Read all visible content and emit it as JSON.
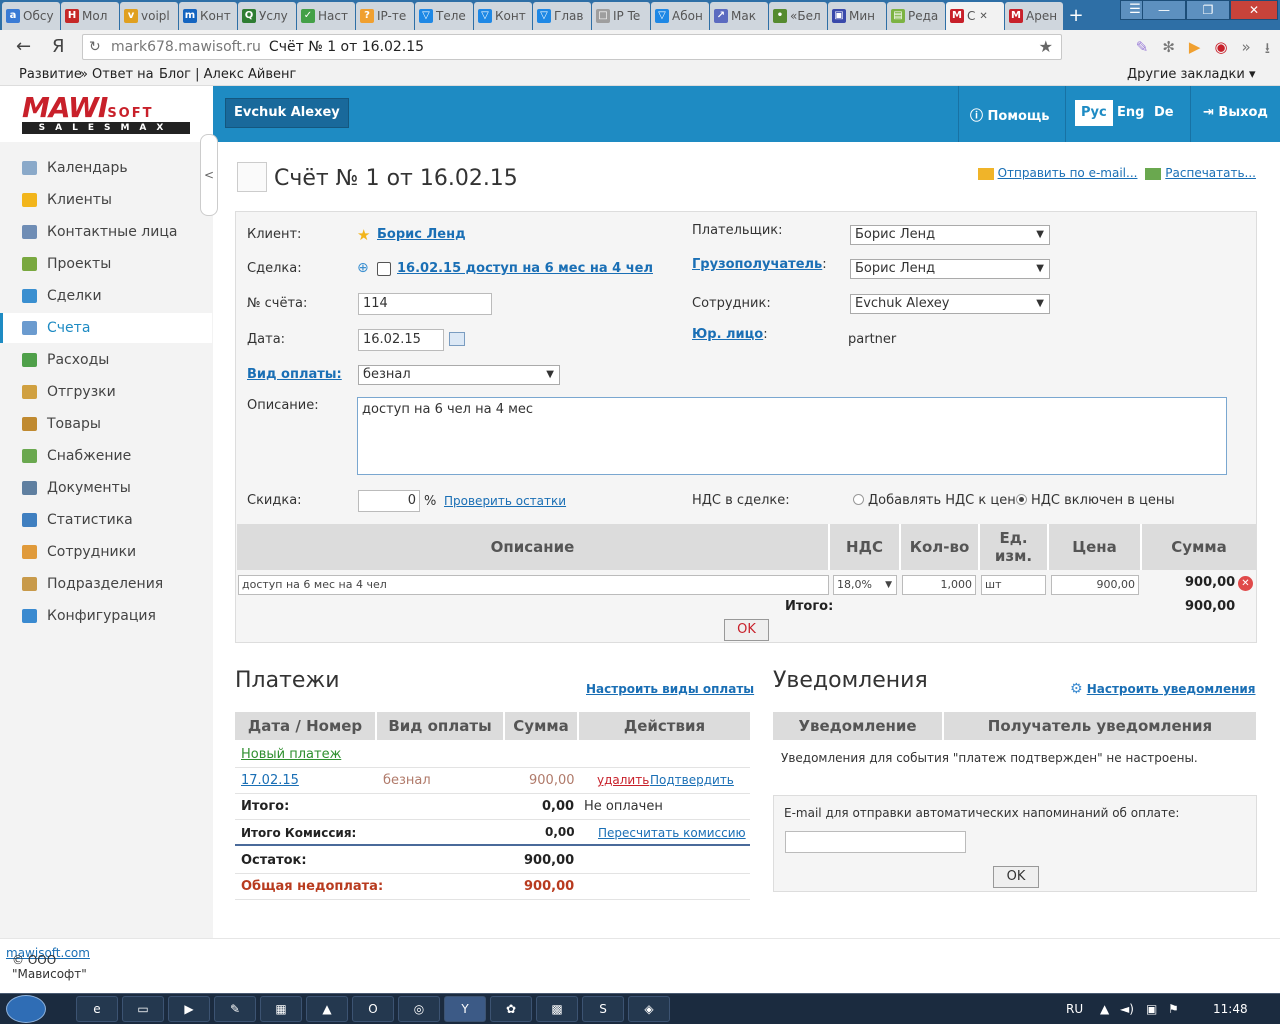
{
  "browser": {
    "tabs": [
      {
        "label": "Обсу",
        "icon": "a",
        "color": "#3a7bd5"
      },
      {
        "label": "Мол",
        "icon": "Н",
        "color": "#c62828"
      },
      {
        "label": "voipl",
        "icon": "v",
        "color": "#e0a020"
      },
      {
        "label": "Конт",
        "icon": "m",
        "color": "#1565c0"
      },
      {
        "label": "Услу",
        "icon": "Q",
        "color": "#2e7d32"
      },
      {
        "label": "Наст",
        "icon": "✓",
        "color": "#43a047"
      },
      {
        "label": "IP-те",
        "icon": "?",
        "color": "#f0a030"
      },
      {
        "label": "Теле",
        "icon": "▽",
        "color": "#1e88e5"
      },
      {
        "label": "Конт",
        "icon": "▽",
        "color": "#1e88e5"
      },
      {
        "label": "Глав",
        "icon": "▽",
        "color": "#1e88e5"
      },
      {
        "label": "IP Te",
        "icon": "□",
        "color": "#9e9e9e"
      },
      {
        "label": "Абон",
        "icon": "▽",
        "color": "#1e88e5"
      },
      {
        "label": "Мак",
        "icon": "↗",
        "color": "#5c6bc0"
      },
      {
        "label": "«Бел",
        "icon": "•",
        "color": "#558b2f"
      },
      {
        "label": "Мин",
        "icon": "▣",
        "color": "#3949ab"
      },
      {
        "label": "Реда",
        "icon": "▤",
        "color": "#7cb342"
      },
      {
        "label": "С",
        "icon": "M",
        "color": "#c8202a",
        "active": true
      },
      {
        "label": "Арен",
        "icon": "M",
        "color": "#c8202a"
      }
    ],
    "back_icon": "←",
    "yandex_icon": "Я",
    "url_host": "mark678.mawisoft.ru",
    "url_title": "Счёт № 1 от 16.02.15",
    "bookmarks": {
      "item1": "Развитие",
      "more": "»",
      "item2": "Ответ на",
      "item3": "Блог | Алекс Айвенг",
      "others": "Другие закладки ▾"
    }
  },
  "header": {
    "logo_main": "MAWI",
    "logo_soft": "SOFT",
    "logo_sub": "SALESMAX",
    "user": "Evchuk Alexey",
    "help": "Помощь",
    "langs": [
      "Рус",
      "Eng",
      "De"
    ],
    "exit": "Выход"
  },
  "sidebar": {
    "items": [
      {
        "label": "Календарь",
        "color": "#8aa9c9"
      },
      {
        "label": "Клиенты",
        "color": "#f2b51b"
      },
      {
        "label": "Контактные лица",
        "color": "#6f8db5"
      },
      {
        "label": "Проекты",
        "color": "#79a83f"
      },
      {
        "label": "Сделки",
        "color": "#3a8fd0"
      },
      {
        "label": "Счета",
        "color": "#6b9bcf",
        "active": true
      },
      {
        "label": "Расходы",
        "color": "#4fa04a"
      },
      {
        "label": "Отгрузки",
        "color": "#d0a040"
      },
      {
        "label": "Товары",
        "color": "#c08a30"
      },
      {
        "label": "Снабжение",
        "color": "#6aa84f"
      },
      {
        "label": "Документы",
        "color": "#5f7fa0"
      },
      {
        "label": "Статистика",
        "color": "#3f7fc0"
      },
      {
        "label": "Сотрудники",
        "color": "#e09a3a"
      },
      {
        "label": "Подразделения",
        "color": "#c89a4a"
      },
      {
        "label": "Конфигурация",
        "color": "#3a8ad0"
      }
    ],
    "collapse": "<"
  },
  "page": {
    "title": "Счёт № 1 от 16.02.15",
    "send_email": "Отправить по e-mail...",
    "print": "Распечатать..."
  },
  "form": {
    "client_label": "Клиент:",
    "client_value": "Борис Ленд",
    "deal_label": "Сделка:",
    "deal_value": "16.02.15 доступ на 6 мес на 4 чел",
    "number_label": "№ счёта:",
    "number_value": "114",
    "date_label": "Дата:",
    "date_value": "16.02.15",
    "payment_type_label": "Вид оплаты:",
    "payment_type_value": "безнал",
    "description_label": "Описание:",
    "description_value": "доступ на 6 чел на 4 мес",
    "discount_label": "Скидка:",
    "discount_value": "0",
    "discount_unit": "%",
    "check_stock": "Проверить остатки",
    "payer_label": "Плательщик:",
    "payer_value": "Борис Ленд",
    "consignee_label": "Грузополучатель",
    "consignee_colon": ":",
    "consignee_value": "Борис Ленд",
    "employee_label": "Сотрудник:",
    "employee_value": "Evchuk Alexey",
    "legal_label": "Юр. лицо",
    "legal_colon": ":",
    "legal_value": "partner",
    "vat_label": "НДС в сделке:",
    "vat_option1": "Добавлять НДС к цене",
    "vat_option2": "НДС включен в цены",
    "vat_selected": 2
  },
  "items_table": {
    "headers": [
      "Описание",
      "НДС",
      "Кол-во",
      "Ед. изм.",
      "Цена",
      "Сумма"
    ],
    "rows": [
      {
        "description": "доступ на 6 мес на 4 чел",
        "vat": "18,0%",
        "qty": "1,000",
        "unit": "шт",
        "price": "900,00",
        "sum": "900,00"
      }
    ],
    "total_label": "Итого:",
    "total_value": "900,00",
    "ok": "OK"
  },
  "payments": {
    "title": "Платежи",
    "configure": "Настроить виды оплаты",
    "headers": [
      "Дата / Номер",
      "Вид оплаты",
      "Сумма",
      "Действия"
    ],
    "new_payment": "Новый платеж",
    "rows": [
      {
        "date": "17.02.15",
        "type": "безнал",
        "amount": "900,00",
        "delete": "удалить",
        "confirm": "Подтвердить"
      }
    ],
    "total_label": "Итого:",
    "total_value": "0,00",
    "total_status": "Не оплачен",
    "commission_label": "Итого Комиссия:",
    "commission_value": "0,00",
    "recalc": "Пересчитать комиссию",
    "balance_label": "Остаток:",
    "balance_value": "900,00",
    "underpay_label": "Общая недоплата:",
    "underpay_value": "900,00"
  },
  "notifications": {
    "title": "Уведомления",
    "configure": "Настроить уведомления",
    "headers": [
      "Уведомление",
      "Получатель уведомления"
    ],
    "empty_text": "Уведомления для события \"платеж подтвержден\" не настроены.",
    "email_label": "E-mail для отправки автоматических напоминаний об оплате:",
    "email_value": "",
    "ok": "OK"
  },
  "footer": {
    "copyright": "© ООО \"Мависофт\"",
    "link": "mawisoft.com"
  },
  "taskbar": {
    "lang": "RU",
    "time": "11:48"
  }
}
